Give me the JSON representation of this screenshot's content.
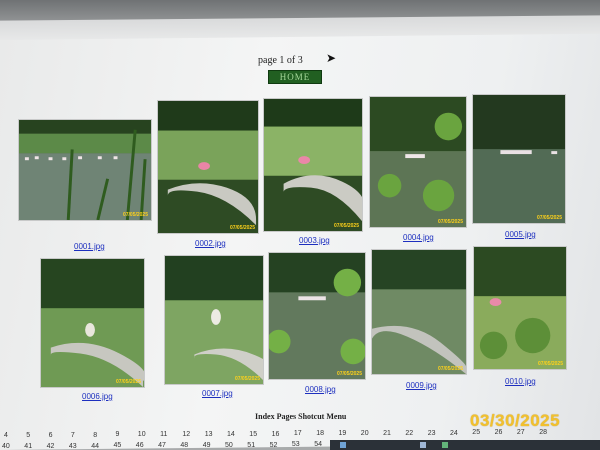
{
  "pager": {
    "text": "page 1 of 3",
    "next_icon": "right-arrow-icon"
  },
  "home": {
    "label": "HOME"
  },
  "thumbnails": [
    {
      "file": "0001.jpg",
      "date": "07/05/2025"
    },
    {
      "file": "0002.jpg",
      "date": "07/05/2025"
    },
    {
      "file": "0003.jpg",
      "date": "07/05/2025"
    },
    {
      "file": "0004.jpg",
      "date": "07/05/2025"
    },
    {
      "file": "0005.jpg",
      "date": "07/05/2025"
    },
    {
      "file": "0006.jpg",
      "date": "07/05/2025"
    },
    {
      "file": "0007.jpg",
      "date": "07/05/2025"
    },
    {
      "file": "0008.jpg",
      "date": "07/05/2025"
    },
    {
      "file": "0009.jpg",
      "date": "07/05/2025"
    },
    {
      "file": "0010.jpg",
      "date": "07/05/2025"
    }
  ],
  "menu": {
    "title": "Index Pages Shotcut Menu",
    "row1": [
      "4",
      "5",
      "6",
      "7",
      "8",
      "9",
      "10",
      "11",
      "12",
      "13",
      "14",
      "15",
      "16",
      "17",
      "18",
      "19",
      "20",
      "21",
      "22",
      "23",
      "24",
      "25",
      "26",
      "27",
      "28"
    ],
    "row2": [
      "40",
      "41",
      "42",
      "43",
      "44",
      "45",
      "46",
      "47",
      "48",
      "49",
      "50",
      "51",
      "52",
      "53",
      "54",
      "55",
      "56",
      "57",
      "58",
      "59",
      "60",
      "61",
      "62",
      "63",
      "64"
    ]
  },
  "photo_date_stamp": "03/30/2025",
  "colors": {
    "link": "#1d2fbf",
    "home_bg": "#215f21",
    "stamp": "#f2c12e"
  }
}
